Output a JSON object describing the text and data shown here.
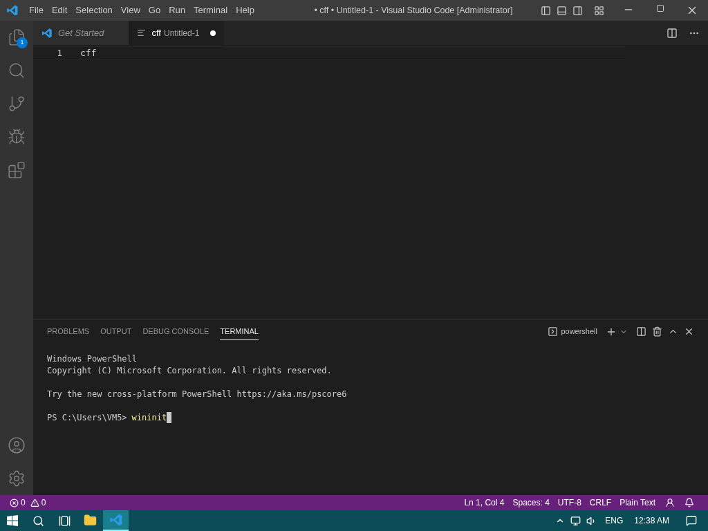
{
  "window": {
    "title": "• cff • Untitled-1 - Visual Studio Code [Administrator]"
  },
  "menu": [
    "File",
    "Edit",
    "Selection",
    "View",
    "Go",
    "Run",
    "Terminal",
    "Help"
  ],
  "activity_bar": {
    "items": [
      {
        "kind": "explorer",
        "badge": "1"
      },
      {
        "kind": "search"
      },
      {
        "kind": "source_control"
      },
      {
        "kind": "run_debug"
      },
      {
        "kind": "extensions"
      }
    ],
    "bottom_items": [
      {
        "kind": "accounts"
      },
      {
        "kind": "settings"
      }
    ]
  },
  "editor_tabs": [
    {
      "kind": "welcome",
      "label": "Get Started",
      "selected": false,
      "dirty": false
    },
    {
      "kind": "text",
      "label": "cff",
      "description": "Untitled-1",
      "selected": true,
      "dirty": true
    }
  ],
  "editor": {
    "lines": [
      {
        "number": "1",
        "text": "cff"
      }
    ]
  },
  "panel": {
    "tabs": [
      {
        "label": "PROBLEMS",
        "selected": false
      },
      {
        "label": "OUTPUT",
        "selected": false
      },
      {
        "label": "DEBUG CONSOLE",
        "selected": false
      },
      {
        "label": "TERMINAL",
        "selected": true
      }
    ],
    "terminal_profile": "powershell",
    "terminal_blocks": [
      [
        "Windows PowerShell",
        "Copyright (C) Microsoft Corporation. All rights reserved."
      ],
      [
        "Try the new cross-platform PowerShell https://aka.ms/pscore6"
      ]
    ],
    "prompt": "PS C:\\Users\\VM5>",
    "command": "wininit"
  },
  "status_bar": {
    "errors": "0",
    "warnings": "0",
    "items": [
      "Ln 1, Col 4",
      "Spaces: 4",
      "UTF-8",
      "CRLF",
      "Plain Text"
    ]
  },
  "taskbar": {
    "apps": [
      {
        "kind": "file_explorer",
        "selected": false
      },
      {
        "kind": "vscode",
        "selected": true
      }
    ],
    "language": "ENG",
    "time": "12:38 AM"
  }
}
